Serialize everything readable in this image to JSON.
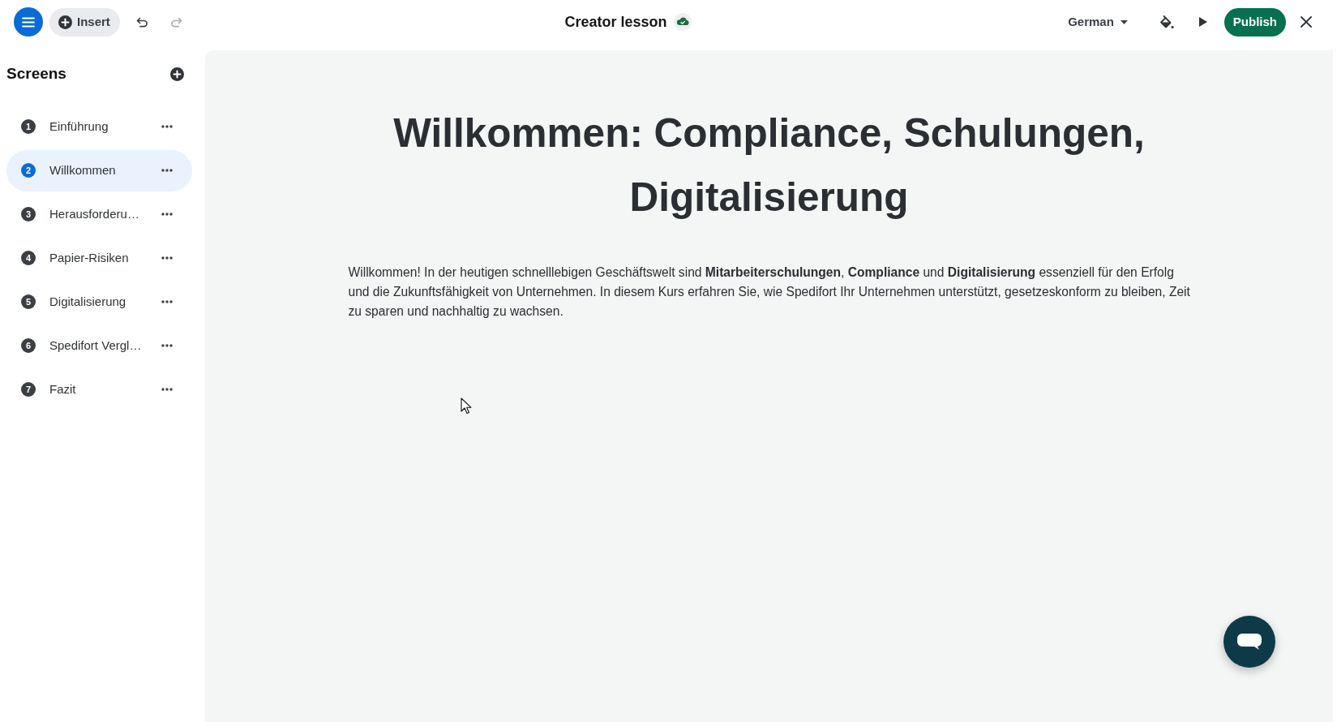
{
  "toolbar": {
    "insert": "Insert",
    "undo": {
      "disabled": false
    },
    "redo": {
      "disabled": true
    }
  },
  "title": "Creator lesson",
  "language": "German",
  "publish": "Publish",
  "sidebar": {
    "title": "Screens",
    "items": [
      {
        "number": "1",
        "label": "Einführung",
        "selected": false
      },
      {
        "number": "2",
        "label": "Willkommen",
        "selected": true
      },
      {
        "number": "3",
        "label": "Herausforderu…",
        "selected": false
      },
      {
        "number": "4",
        "label": "Papier-Risiken",
        "selected": false
      },
      {
        "number": "5",
        "label": "Digitalisierung",
        "selected": false
      },
      {
        "number": "6",
        "label": "Spedifort Vergl…",
        "selected": false
      },
      {
        "number": "7",
        "label": "Fazit",
        "selected": false
      }
    ]
  },
  "content": {
    "heading": "Willkommen: Compliance, Schulungen, Digitalisierung",
    "body": "Willkommen! In der heutigen schnelllebigen Geschäftswelt sind **Mitarbeiterschulungen**, **Compliance** und **Digitalisierung** essenziell für den Erfolg und die Zukunftsfähigkeit von Unternehmen. In diesem Kurs erfahren Sie, wie Spedifort Ihr Unternehmen unterstützt, gesetzeskonform zu bleiben, Zeit zu sparen und nachhaltig zu wachsen."
  }
}
